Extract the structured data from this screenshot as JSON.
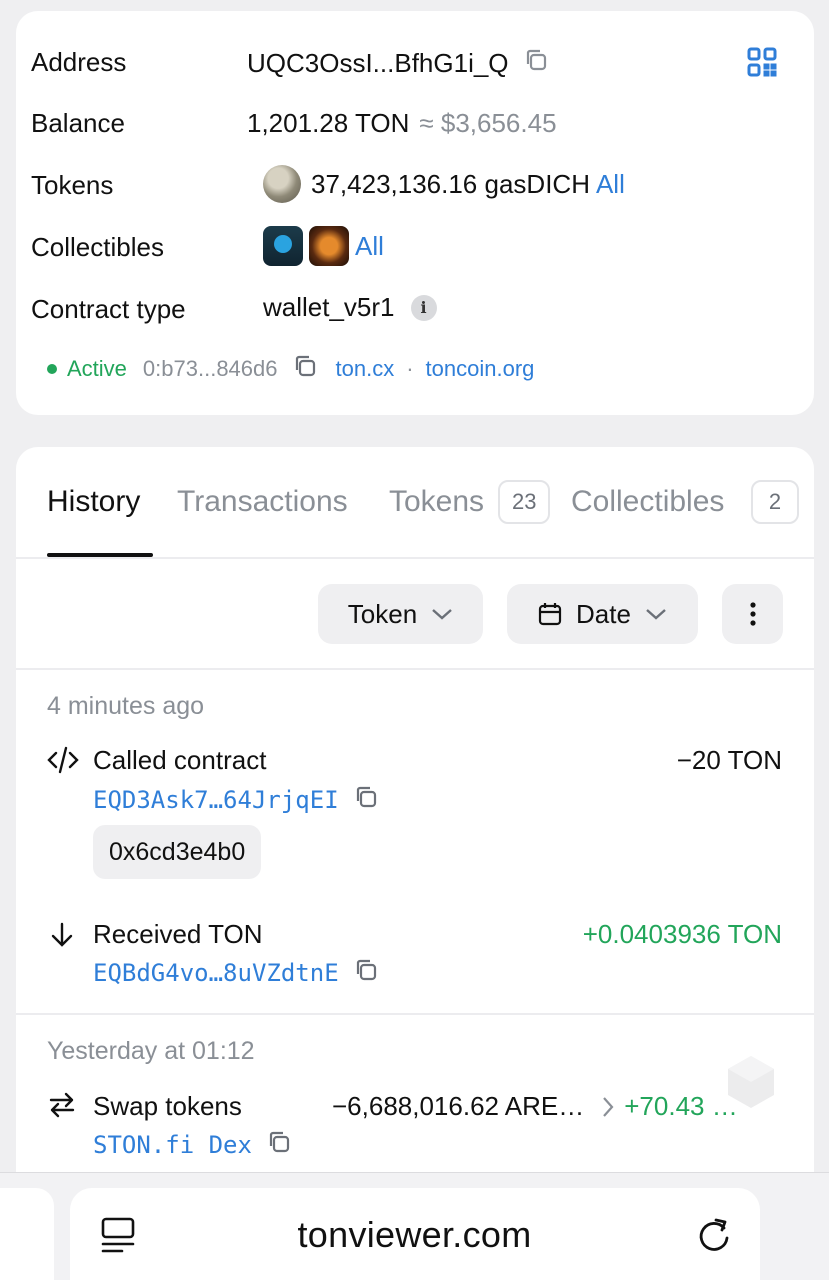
{
  "info": {
    "address_label": "Address",
    "address_value": "UQC3OssI...BfhG1i_Q",
    "balance_label": "Balance",
    "balance_value": "1,201.28 TON",
    "balance_usd": "≈ $3,656.45",
    "tokens_label": "Tokens",
    "tokens_value": "37,423,136.16 gasDICH",
    "tokens_all": "All",
    "collectibles_label": "Collectibles",
    "collectibles_all": "All",
    "contract_label": "Contract type",
    "contract_value": "wallet_v5r1",
    "status_text": "Active",
    "raw_address": "0:b73...846d6",
    "link_tonCx": "ton.cx",
    "separator": "·",
    "link_toncoin": "toncoin.org"
  },
  "tabs": {
    "history": "History",
    "transactions": "Transactions",
    "tokens": "Tokens",
    "tokens_count": "23",
    "collectibles": "Collectibles",
    "collectibles_count": "2"
  },
  "filters": {
    "token": "Token",
    "date": "Date"
  },
  "groups": [
    {
      "date": "4 minutes ago",
      "items": [
        {
          "title": "Called contract",
          "address": "EQD3Ask7…64JrjqEI",
          "amount": "−20 TON",
          "hash": "0x6cd3e4b0"
        },
        {
          "title": "Received TON",
          "address": "EQBdG4vo…8uVZdtnE",
          "amount": "+0.0403936 TON"
        }
      ]
    },
    {
      "date": "Yesterday at 01:12",
      "items": [
        {
          "title": "Swap tokens",
          "address": "STON.fi Dex",
          "amount_out": "−6,688,016.62 ARE…",
          "amount_in": "+70.43 …"
        }
      ]
    }
  ],
  "browser": {
    "url": "tonviewer.com"
  },
  "colors": {
    "accent": "#2f7ed8",
    "positive": "#22a55a",
    "muted": "#8a8f96"
  }
}
